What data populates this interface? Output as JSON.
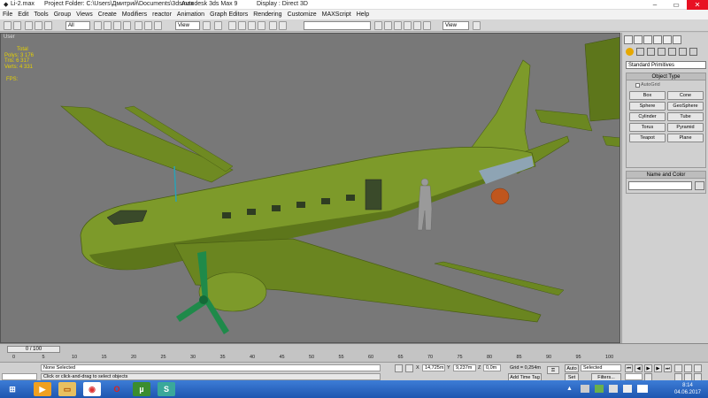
{
  "window": {
    "filename": "Li-2.max",
    "project_folder": "Project Folder: C:\\Users\\Дмитрий\\Documents\\3dsmax",
    "app_title": "Autodesk 3ds Max 9",
    "display": "Display : Direct 3D"
  },
  "menu": [
    "File",
    "Edit",
    "Tools",
    "Group",
    "Views",
    "Create",
    "Modifiers",
    "reactor",
    "Animation",
    "Graph Editors",
    "Rendering",
    "Customize",
    "MAXScript",
    "Help"
  ],
  "toolbar": {
    "selection_filter": "All",
    "ref_coord": "View",
    "named_selection": "",
    "view_dd": "View"
  },
  "viewport": {
    "label": "User",
    "stats": {
      "total_label": "Total",
      "polys": "Polys: 3 176",
      "tris": "Tris:    6 317",
      "verts": "Verts:  4 331"
    },
    "fps": "FPS:"
  },
  "command_panel": {
    "category": "Standard Primitives",
    "object_type_title": "Object Type",
    "autogrid": "AutoGrid",
    "primitives": [
      "Box",
      "Cone",
      "Sphere",
      "GeoSphere",
      "Cylinder",
      "Tube",
      "Torus",
      "Pyramid",
      "Teapot",
      "Plane"
    ],
    "name_color_title": "Name and Color",
    "name_value": ""
  },
  "timeline": {
    "slider": "0 / 100",
    "ticks": [
      "0",
      "5",
      "10",
      "15",
      "20",
      "25",
      "30",
      "35",
      "40",
      "45",
      "50",
      "55",
      "60",
      "65",
      "70",
      "75",
      "80",
      "85",
      "90",
      "95",
      "100"
    ]
  },
  "status": {
    "selection": "None Selected",
    "prompt": "Click or click-and-drag to select objects",
    "x": "14,725m",
    "y": "9,237m",
    "z": "0,0m",
    "grid": "Grid = 0,254m",
    "add_time_tag": "Add Time Tag",
    "auto": "Auto",
    "selected": "Selected",
    "setk": "Set K.",
    "filters": "Filters..."
  },
  "clock": {
    "time": "8:14",
    "date": "04.06.2017"
  },
  "colors": {
    "plane": "#7d9a2a",
    "viewport": "#787878",
    "taskbar": "#2a66c4"
  }
}
